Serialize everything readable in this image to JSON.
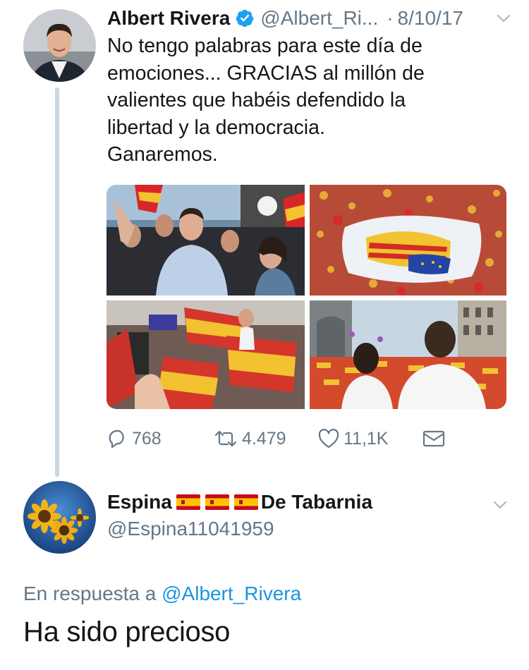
{
  "tweet": {
    "author_name": "Albert Rivera",
    "author_handle": "@Albert_Ri...",
    "separator": "·",
    "date": "8/10/17",
    "text_lines": [
      "No tengo palabras para este día de",
      "emociones... GRACIAS al millón de",
      "valientes que habéis defendido la",
      "libertad y la democracia.",
      "Ganaremos."
    ],
    "actions": {
      "replies": "768",
      "retweets": "4.479",
      "likes": "11,1K"
    }
  },
  "reply": {
    "author_name_start": "Espina",
    "author_name_end": "De Tabarnia",
    "author_handle": "@Espina11041959",
    "in_reply_to_label": "En respuesta a",
    "in_reply_to_handle": "@Albert_Rivera",
    "text": "Ha sido precioso"
  },
  "icons": {
    "verified": "verified-badge-icon",
    "caret": "chevron-down-icon",
    "reply": "reply-icon",
    "retweet": "retweet-icon",
    "like": "heart-icon",
    "message": "envelope-icon",
    "flag": "spain-flag-icon"
  },
  "colors": {
    "text": "#14171a",
    "secondary": "#657786",
    "link": "#1b95e0",
    "verified": "#1da1f2",
    "thread_line": "#ccd6dd"
  }
}
